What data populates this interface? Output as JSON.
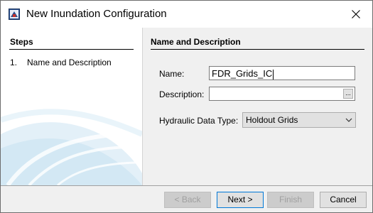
{
  "window": {
    "title": "New Inundation Configuration",
    "icon": "app-window-icon",
    "close_icon": "close-icon"
  },
  "steps": {
    "heading": "Steps",
    "items": [
      {
        "number": "1.",
        "label": "Name and Description"
      }
    ]
  },
  "section": {
    "heading": "Name and Description"
  },
  "form": {
    "name_label": "Name:",
    "name_value": "FDR_Grids_IC",
    "description_label": "Description:",
    "description_value": "",
    "browse_label": "...",
    "hydraulic_label": "Hydraulic Data Type:",
    "hydraulic_value": "Holdout Grids"
  },
  "buttons": {
    "back": "< Back",
    "next": "Next >",
    "finish": "Finish",
    "cancel": "Cancel"
  },
  "colors": {
    "accent": "#0078d7",
    "swoosh": "#cfe6f3"
  }
}
